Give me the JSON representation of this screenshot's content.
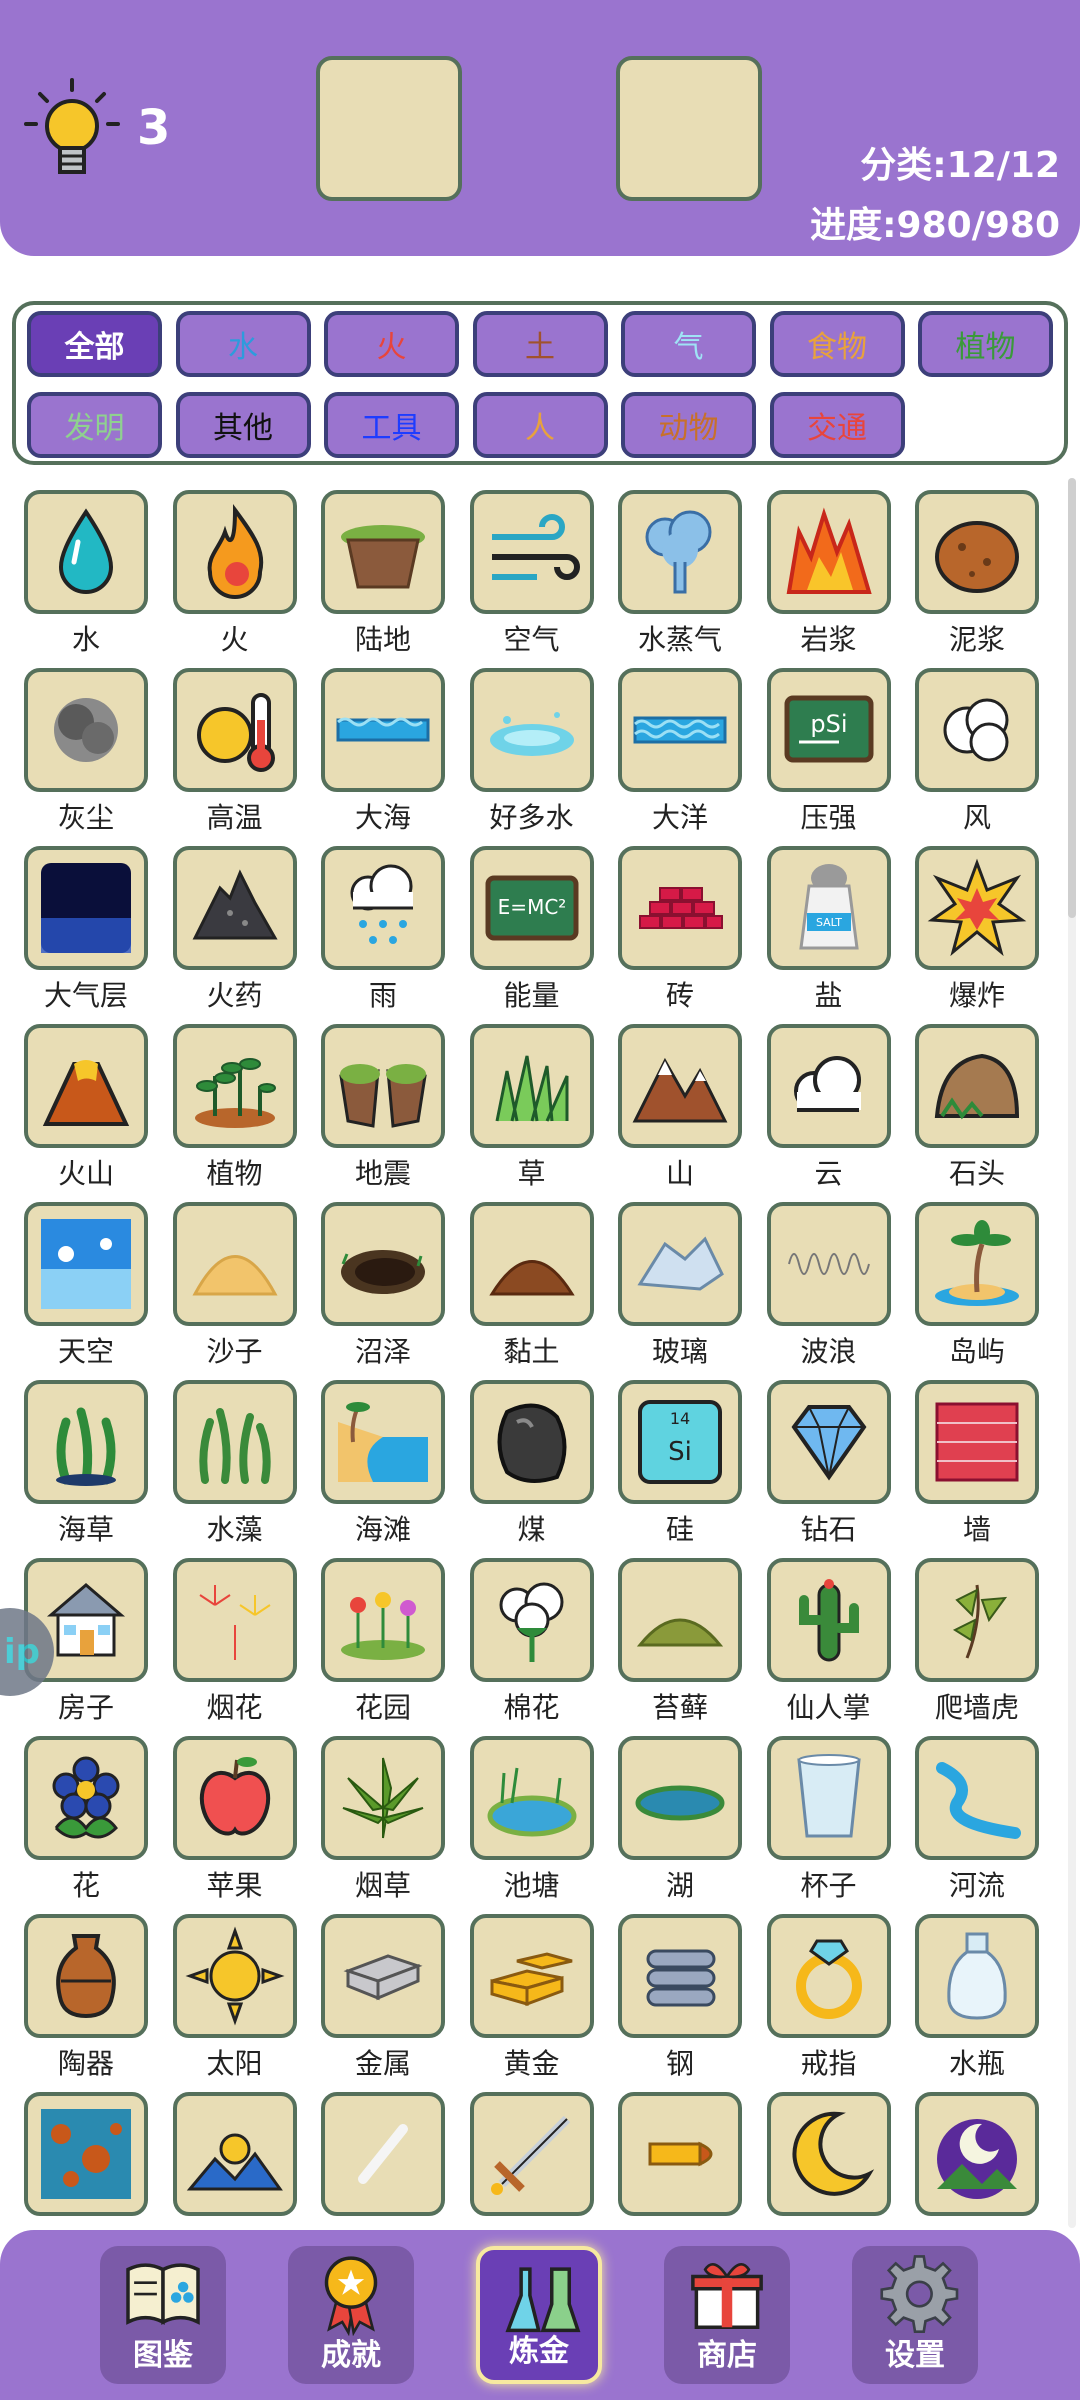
{
  "header": {
    "hint_count": "3",
    "category_stat": "分类:12/12",
    "progress_stat": "进度:980/980"
  },
  "categories": [
    {
      "label": "全部",
      "color": "#ffffff",
      "active": true
    },
    {
      "label": "水",
      "color": "#2e9bdc"
    },
    {
      "label": "火",
      "color": "#e8453c"
    },
    {
      "label": "土",
      "color": "#a0522d"
    },
    {
      "label": "气",
      "color": "#9fe3f5"
    },
    {
      "label": "食物",
      "color": "#e8a23c"
    },
    {
      "label": "植物",
      "color": "#3a9a3a"
    },
    {
      "label": "发明",
      "color": "#8fd18f"
    },
    {
      "label": "其他",
      "color": "#111111"
    },
    {
      "label": "工具",
      "color": "#1e3cff"
    },
    {
      "label": "人",
      "color": "#e8a23c"
    },
    {
      "label": "动物",
      "color": "#c8702a"
    },
    {
      "label": "交通",
      "color": "#e8453c"
    }
  ],
  "elements": [
    {
      "label": "水",
      "icon": "water-drop-icon"
    },
    {
      "label": "火",
      "icon": "fire-icon"
    },
    {
      "label": "陆地",
      "icon": "land-icon"
    },
    {
      "label": "空气",
      "icon": "air-icon"
    },
    {
      "label": "水蒸气",
      "icon": "steam-icon"
    },
    {
      "label": "岩浆",
      "icon": "lava-icon"
    },
    {
      "label": "泥浆",
      "icon": "mud-icon"
    },
    {
      "label": "灰尘",
      "icon": "dust-icon"
    },
    {
      "label": "高温",
      "icon": "heat-icon"
    },
    {
      "label": "大海",
      "icon": "sea-icon"
    },
    {
      "label": "好多水",
      "icon": "puddle-icon"
    },
    {
      "label": "大洋",
      "icon": "ocean-icon"
    },
    {
      "label": "压强",
      "icon": "pressure-icon"
    },
    {
      "label": "风",
      "icon": "wind-icon"
    },
    {
      "label": "大气层",
      "icon": "atmosphere-icon"
    },
    {
      "label": "火药",
      "icon": "gunpowder-icon"
    },
    {
      "label": "雨",
      "icon": "rain-icon"
    },
    {
      "label": "能量",
      "icon": "energy-icon"
    },
    {
      "label": "砖",
      "icon": "brick-icon"
    },
    {
      "label": "盐",
      "icon": "salt-icon"
    },
    {
      "label": "爆炸",
      "icon": "explosion-icon"
    },
    {
      "label": "火山",
      "icon": "volcano-icon"
    },
    {
      "label": "植物",
      "icon": "plant-icon"
    },
    {
      "label": "地震",
      "icon": "earthquake-icon"
    },
    {
      "label": "草",
      "icon": "grass-icon"
    },
    {
      "label": "山",
      "icon": "mountain-icon"
    },
    {
      "label": "云",
      "icon": "cloud-icon"
    },
    {
      "label": "石头",
      "icon": "stone-icon"
    },
    {
      "label": "天空",
      "icon": "sky-icon"
    },
    {
      "label": "沙子",
      "icon": "sand-icon"
    },
    {
      "label": "沼泽",
      "icon": "swamp-icon"
    },
    {
      "label": "黏土",
      "icon": "clay-icon"
    },
    {
      "label": "玻璃",
      "icon": "glass-icon"
    },
    {
      "label": "波浪",
      "icon": "wave-icon"
    },
    {
      "label": "岛屿",
      "icon": "island-icon"
    },
    {
      "label": "海草",
      "icon": "seaweed-icon"
    },
    {
      "label": "水藻",
      "icon": "algae-icon"
    },
    {
      "label": "海滩",
      "icon": "beach-icon"
    },
    {
      "label": "煤",
      "icon": "coal-icon"
    },
    {
      "label": "硅",
      "icon": "silicon-icon",
      "text": "14 Si"
    },
    {
      "label": "钻石",
      "icon": "diamond-icon"
    },
    {
      "label": "墙",
      "icon": "wall-icon"
    },
    {
      "label": "房子",
      "icon": "house-icon"
    },
    {
      "label": "烟花",
      "icon": "fireworks-icon"
    },
    {
      "label": "花园",
      "icon": "garden-icon"
    },
    {
      "label": "棉花",
      "icon": "cotton-icon"
    },
    {
      "label": "苔藓",
      "icon": "moss-icon"
    },
    {
      "label": "仙人掌",
      "icon": "cactus-icon"
    },
    {
      "label": "爬墙虎",
      "icon": "ivy-icon"
    },
    {
      "label": "花",
      "icon": "flower-icon"
    },
    {
      "label": "苹果",
      "icon": "apple-icon"
    },
    {
      "label": "烟草",
      "icon": "tobacco-icon"
    },
    {
      "label": "池塘",
      "icon": "pond-icon"
    },
    {
      "label": "湖",
      "icon": "lake-icon"
    },
    {
      "label": "杯子",
      "icon": "cup-icon"
    },
    {
      "label": "河流",
      "icon": "river-icon"
    },
    {
      "label": "陶器",
      "icon": "pottery-icon"
    },
    {
      "label": "太阳",
      "icon": "sun-icon"
    },
    {
      "label": "金属",
      "icon": "metal-icon"
    },
    {
      "label": "黄金",
      "icon": "gold-icon"
    },
    {
      "label": "钢",
      "icon": "steel-icon"
    },
    {
      "label": "戒指",
      "icon": "ring-icon"
    },
    {
      "label": "水瓶",
      "icon": "bottle-icon"
    },
    {
      "label": "",
      "icon": "rust-icon"
    },
    {
      "label": "",
      "icon": "sunrise-icon"
    },
    {
      "label": "",
      "icon": "chalk-icon"
    },
    {
      "label": "",
      "icon": "sword-icon"
    },
    {
      "label": "",
      "icon": "bullet-icon"
    },
    {
      "label": "",
      "icon": "moon-icon"
    },
    {
      "label": "",
      "icon": "night-icon"
    }
  ],
  "side_tab": "ip",
  "nav": [
    {
      "label": "图鉴",
      "icon": "book-icon"
    },
    {
      "label": "成就",
      "icon": "medal-icon"
    },
    {
      "label": "炼金",
      "icon": "flask-icon",
      "active": true
    },
    {
      "label": "商店",
      "icon": "gift-icon"
    },
    {
      "label": "设置",
      "icon": "gear-icon"
    }
  ],
  "colors": {
    "header_bg": "#9a74cf",
    "tile_bg": "#e8ddb5",
    "tile_border": "#55705b",
    "active_chip": "#6a3fb5"
  }
}
